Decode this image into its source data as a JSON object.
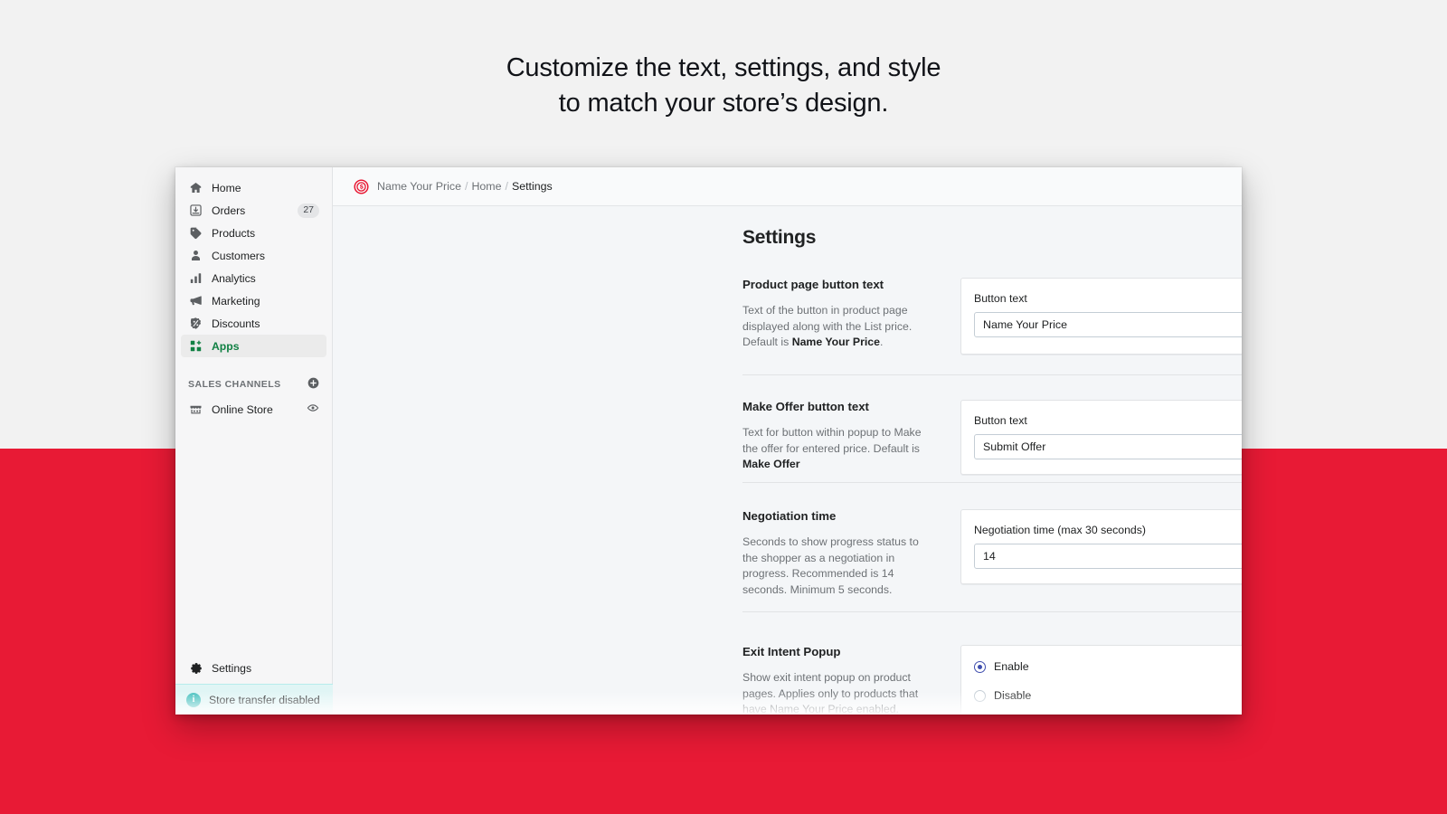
{
  "headline": {
    "line1": "Customize the text, settings, and style",
    "line2": "to match your store’s design."
  },
  "colors": {
    "background_top": "#f2f2f2",
    "background_band": "#e81a35",
    "accent_green": "#108043",
    "accent_indigo": "#3f4eae",
    "banner_teal": "#47c1bf",
    "logo_red": "#e8112d"
  },
  "sidebar": {
    "items": [
      {
        "label": "Home",
        "icon": "home-icon",
        "badge": "",
        "active": false
      },
      {
        "label": "Orders",
        "icon": "orders-icon",
        "badge": "27",
        "active": false
      },
      {
        "label": "Products",
        "icon": "products-tag-icon",
        "badge": "",
        "active": false
      },
      {
        "label": "Customers",
        "icon": "customers-person-icon",
        "badge": "",
        "active": false
      },
      {
        "label": "Analytics",
        "icon": "analytics-bars-icon",
        "badge": "",
        "active": false
      },
      {
        "label": "Marketing",
        "icon": "marketing-megaphone-icon",
        "badge": "",
        "active": false
      },
      {
        "label": "Discounts",
        "icon": "discounts-tag-percent-icon",
        "badge": "",
        "active": false
      },
      {
        "label": "Apps",
        "icon": "apps-grid-plus-icon",
        "badge": "",
        "active": true
      }
    ],
    "section": {
      "title": "SALES CHANNELS",
      "add_icon": "plus-circle-icon",
      "channels": [
        {
          "label": "Online Store",
          "icon": "storefront-icon",
          "action_icon": "eye-icon"
        }
      ]
    },
    "settings": {
      "label": "Settings",
      "icon": "gear-icon"
    },
    "store_banner": {
      "label": "Store transfer disabled",
      "icon": "info-icon"
    }
  },
  "topbar": {
    "app_logo": "name-your-price-logo",
    "breadcrumb": [
      {
        "label": "Name Your Price",
        "current": false
      },
      {
        "label": "Home",
        "current": false
      },
      {
        "label": "Settings",
        "current": true
      }
    ],
    "separator": "/"
  },
  "page": {
    "title": "Settings",
    "sections": [
      {
        "title": "Product page button text",
        "description_parts": [
          {
            "text": "Text of the button in product page displayed along with the List price. Default is ",
            "bold": false
          },
          {
            "text": "Name Your Price",
            "bold": true
          },
          {
            "text": ".",
            "bold": false
          }
        ],
        "field_label": "Button text",
        "field_value": "Name Your Price",
        "field_placeholder": "Button text",
        "field_icon": "resize-handle-icon",
        "type": "text"
      },
      {
        "title": "Make Offer button text",
        "description_parts": [
          {
            "text": "Text for button within popup to Make the offer for entered price. Default is ",
            "bold": false
          },
          {
            "text": "Make Offer",
            "bold": true
          }
        ],
        "field_label": "Button text",
        "field_value": "Submit Offer",
        "field_placeholder": "Button text",
        "field_icon": "",
        "type": "text"
      },
      {
        "title": "Negotiation time",
        "description_parts": [
          {
            "text": "Seconds to show progress status to the shopper as a negotiation in progress. Recommended is 14 seconds. Minimum 5 seconds.",
            "bold": false
          }
        ],
        "field_label": "Negotiation time (max 30 seconds)",
        "field_value": "14",
        "field_placeholder": "Negotiation time (max 30 seconds)",
        "field_icon": "",
        "type": "text"
      },
      {
        "title": "Exit Intent Popup",
        "description_parts": [
          {
            "text": "Show exit intent popup on product pages. Applies only to products that have Name Your Price enabled.",
            "bold": false
          }
        ],
        "type": "radio",
        "options": [
          {
            "label": "Enable",
            "selected": true
          },
          {
            "label": "Disable",
            "selected": false
          }
        ]
      }
    ]
  }
}
